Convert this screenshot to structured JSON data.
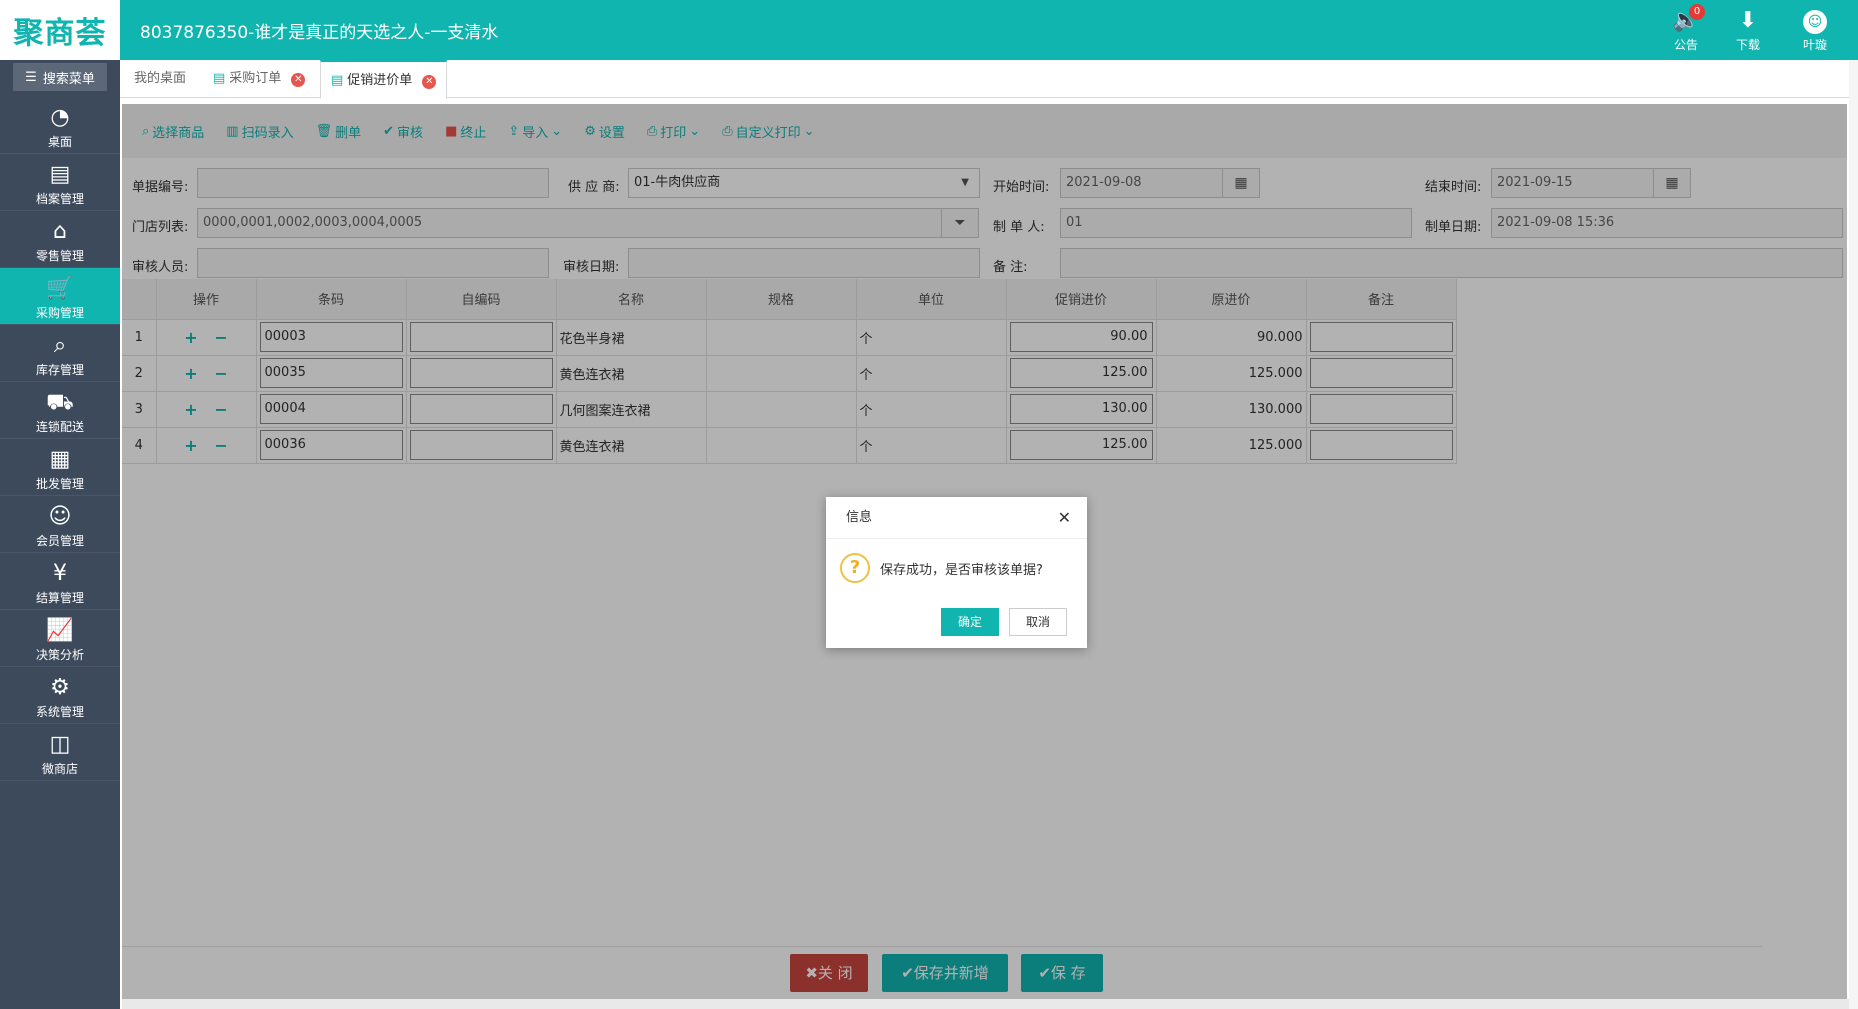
{
  "header": {
    "logo": "聚商荟",
    "title": "8037876350-谁才是真正的天选之人-一支清水",
    "announce": {
      "label": "公告",
      "badge": "0",
      "icon": "speaker-icon"
    },
    "download": {
      "label": "下载",
      "icon": "download-icon"
    },
    "user": {
      "name": "叶璇",
      "icon": "avatar-icon"
    }
  },
  "sidebar": {
    "search_label": "搜索菜单",
    "items": [
      {
        "label": "桌面",
        "icon": "dashboard-icon"
      },
      {
        "label": "档案管理",
        "icon": "archive-icon"
      },
      {
        "label": "零售管理",
        "icon": "store-icon"
      },
      {
        "label": "采购管理",
        "icon": "cart-icon",
        "active": true
      },
      {
        "label": "库存管理",
        "icon": "inventory-search-icon"
      },
      {
        "label": "连锁配送",
        "icon": "truck-icon"
      },
      {
        "label": "批发管理",
        "icon": "wholesale-icon"
      },
      {
        "label": "会员管理",
        "icon": "member-icon"
      },
      {
        "label": "结算管理",
        "icon": "settlement-icon"
      },
      {
        "label": "决策分析",
        "icon": "chart-icon"
      },
      {
        "label": "系统管理",
        "icon": "gear-icon"
      },
      {
        "label": "微商店",
        "icon": "shop-bag-icon"
      }
    ]
  },
  "tabs": [
    {
      "label": "我的桌面"
    },
    {
      "label": "采购订单"
    },
    {
      "label": "促销进价单",
      "active": true
    }
  ],
  "toolbar": {
    "select_goods": "选择商品",
    "scan_entry": "扫码录入",
    "delete": "删单",
    "audit": "审核",
    "stop": "终止",
    "import": "导入",
    "settings": "设置",
    "print": "打印",
    "custom_print": "自定义打印"
  },
  "form": {
    "doc_no_label": "单据编号:",
    "doc_no": "",
    "supplier_label": "供 应 商:",
    "supplier": "01-牛肉供应商",
    "start_label": "开始时间:",
    "start": "2021-09-08",
    "end_label": "结束时间:",
    "end": "2021-09-15",
    "stores_label": "门店列表:",
    "stores": "0000,0001,0002,0003,0004,0005",
    "maker_label": "制 单 人:",
    "maker": "01",
    "make_date_label": "制单日期:",
    "make_date": "2021-09-08 15:36",
    "auditor_label": "审核人员:",
    "auditor": "",
    "audit_date_label": "审核日期:",
    "audit_date": "",
    "remark_label": "备 注:",
    "remark": ""
  },
  "table": {
    "headers": [
      "",
      "操作",
      "条码",
      "自编码",
      "名称",
      "规格",
      "单位",
      "促销进价",
      "原进价",
      "备注"
    ],
    "rows": [
      {
        "no": "1",
        "barcode": "00003",
        "code": "",
        "name": "花色半身裙",
        "spec": "",
        "unit": "个",
        "promo_price": "90.00",
        "orig_price": "90.000",
        "note": ""
      },
      {
        "no": "2",
        "barcode": "00035",
        "code": "",
        "name": "黄色连衣裙",
        "spec": "",
        "unit": "个",
        "promo_price": "125.00",
        "orig_price": "125.000",
        "note": ""
      },
      {
        "no": "3",
        "barcode": "00004",
        "code": "",
        "name": "几何图案连衣裙",
        "spec": "",
        "unit": "个",
        "promo_price": "130.00",
        "orig_price": "130.000",
        "note": ""
      },
      {
        "no": "4",
        "barcode": "00036",
        "code": "",
        "name": "黄色连衣裙",
        "spec": "",
        "unit": "个",
        "promo_price": "125.00",
        "orig_price": "125.000",
        "note": ""
      }
    ]
  },
  "footer": {
    "close": "关 闭",
    "save_new": "保存并新增",
    "save": "保 存"
  },
  "dialog": {
    "title": "信息",
    "message": "保存成功，是否审核该单据?",
    "ok": "确定",
    "cancel": "取消"
  },
  "colors": {
    "accent": "#10b5b0",
    "sidebar": "#3d4a5c",
    "danger": "#c9453f"
  }
}
